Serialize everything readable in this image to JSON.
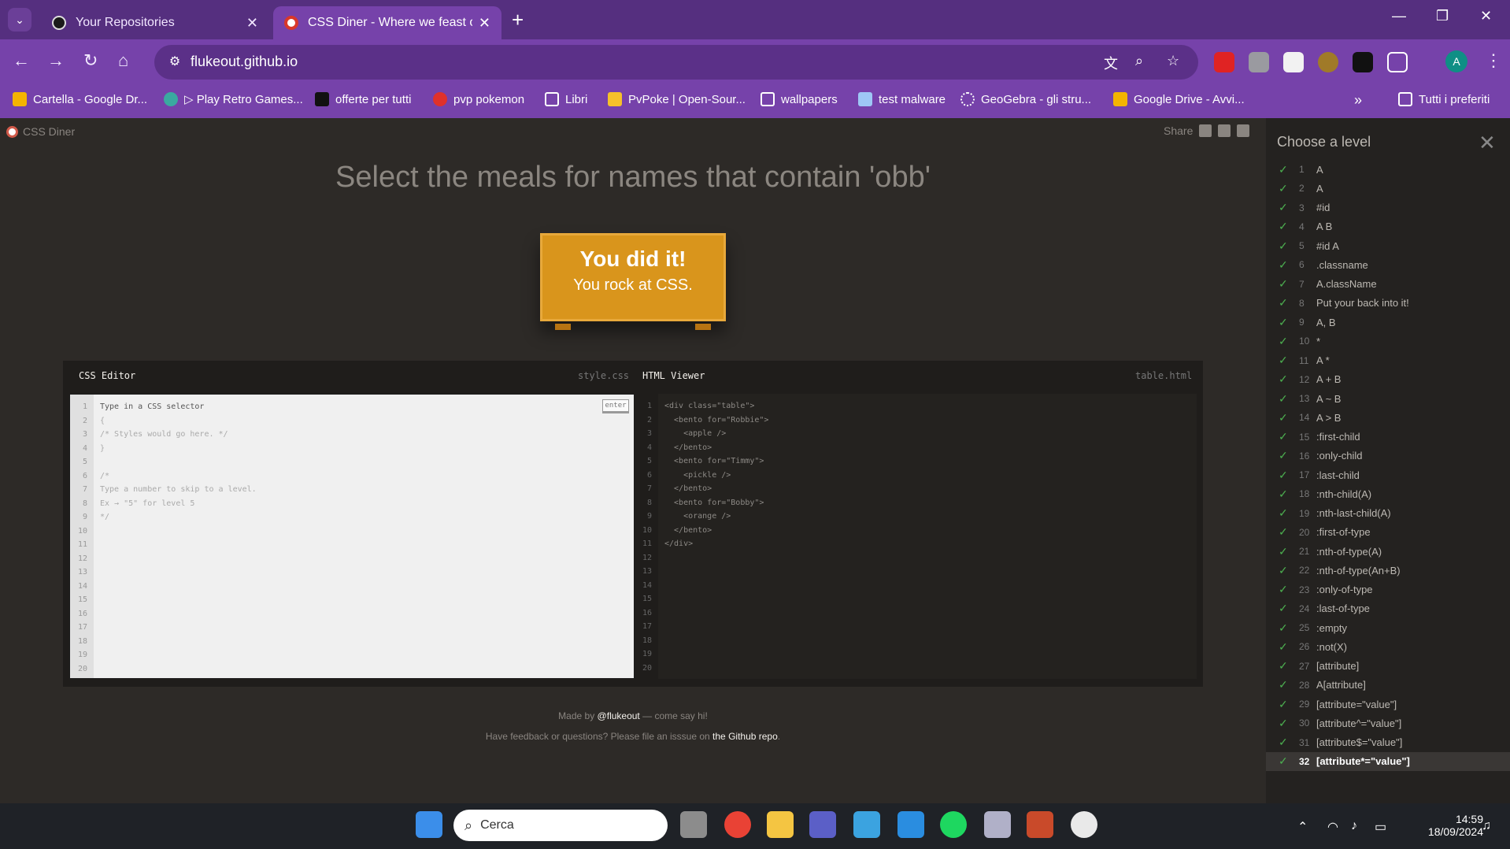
{
  "browser": {
    "tabs": [
      {
        "title": "Your Repositories"
      },
      {
        "title": "CSS Diner - Where we feast on"
      }
    ],
    "url": "flukeout.github.io",
    "bookmarks": [
      {
        "label": "Cartella - Google Dr..."
      },
      {
        "label": "▷ Play Retro Games..."
      },
      {
        "label": "offerte per tutti"
      },
      {
        "label": "pvp pokemon"
      },
      {
        "label": "Libri"
      },
      {
        "label": "PvPoke | Open-Sour..."
      },
      {
        "label": "wallpapers"
      },
      {
        "label": "test malware"
      },
      {
        "label": "GeoGebra - gli stru..."
      },
      {
        "label": "Google Drive - Avvi..."
      },
      {
        "label": "Tutti i preferiti"
      }
    ],
    "profile_initial": "A"
  },
  "page": {
    "brand": "CSS Diner",
    "share_label": "Share",
    "instruction": "Select the meals for names that contain 'obb'",
    "table_line1": "You did it!",
    "table_line2": "You rock at CSS.",
    "css_editor_title": "CSS Editor",
    "css_editor_file": "style.css",
    "html_viewer_title": "HTML Viewer",
    "html_viewer_file": "table.html",
    "enter_button": "enter",
    "css_lines": [
      "Type in a CSS selector",
      "{",
      "/* Styles would go here. */",
      "}",
      "",
      "/*",
      "Type a number to skip to a level.",
      "Ex → \"5\" for level 5",
      "*/"
    ],
    "html_lines": [
      "<div class=\"table\">",
      "  <bento for=\"Robbie\">",
      "    <apple />",
      "  </bento>",
      "  <bento for=\"Timmy\">",
      "    <pickle />",
      "  </bento>",
      "  <bento for=\"Bobby\">",
      "    <orange />",
      "  </bento>",
      "</div>"
    ],
    "footer_made_by": "Made by",
    "footer_author": "@flukeout",
    "footer_say_hi": "— come say hi!",
    "footer_feedback": "Have feedback or questions? Please file an isssue on",
    "footer_repo": "the Github repo",
    "footer_period": "."
  },
  "sidebar": {
    "title": "Choose a level",
    "levels": [
      {
        "n": "1",
        "name": "A"
      },
      {
        "n": "2",
        "name": "A"
      },
      {
        "n": "3",
        "name": "#id"
      },
      {
        "n": "4",
        "name": "A B"
      },
      {
        "n": "5",
        "name": "#id A"
      },
      {
        "n": "6",
        "name": ".classname"
      },
      {
        "n": "7",
        "name": "A.className"
      },
      {
        "n": "8",
        "name": "Put your back into it!"
      },
      {
        "n": "9",
        "name": "A, B"
      },
      {
        "n": "10",
        "name": "*"
      },
      {
        "n": "11",
        "name": "A *"
      },
      {
        "n": "12",
        "name": "A + B"
      },
      {
        "n": "13",
        "name": "A ~ B"
      },
      {
        "n": "14",
        "name": "A > B"
      },
      {
        "n": "15",
        "name": ":first-child"
      },
      {
        "n": "16",
        "name": ":only-child"
      },
      {
        "n": "17",
        "name": ":last-child"
      },
      {
        "n": "18",
        "name": ":nth-child(A)"
      },
      {
        "n": "19",
        "name": ":nth-last-child(A)"
      },
      {
        "n": "20",
        "name": ":first-of-type"
      },
      {
        "n": "21",
        "name": ":nth-of-type(A)"
      },
      {
        "n": "22",
        "name": ":nth-of-type(An+B)"
      },
      {
        "n": "23",
        "name": ":only-of-type"
      },
      {
        "n": "24",
        "name": ":last-of-type"
      },
      {
        "n": "25",
        "name": ":empty"
      },
      {
        "n": "26",
        "name": ":not(X)"
      },
      {
        "n": "27",
        "name": "[attribute]"
      },
      {
        "n": "28",
        "name": "A[attribute]"
      },
      {
        "n": "29",
        "name": "[attribute=\"value\"]"
      },
      {
        "n": "30",
        "name": "[attribute^=\"value\"]"
      },
      {
        "n": "31",
        "name": "[attribute$=\"value\"]"
      },
      {
        "n": "32",
        "name": "[attribute*=\"value\"]"
      }
    ],
    "active_level": "32"
  },
  "taskbar": {
    "search_placeholder": "Cerca",
    "time": "14:59",
    "date": "18/09/2024"
  },
  "colors": {
    "titlebar": "#552f7f",
    "toolbar": "#7642aa",
    "page_bg": "#2d2a27",
    "table": "#d9951c",
    "check": "#4caf50"
  }
}
